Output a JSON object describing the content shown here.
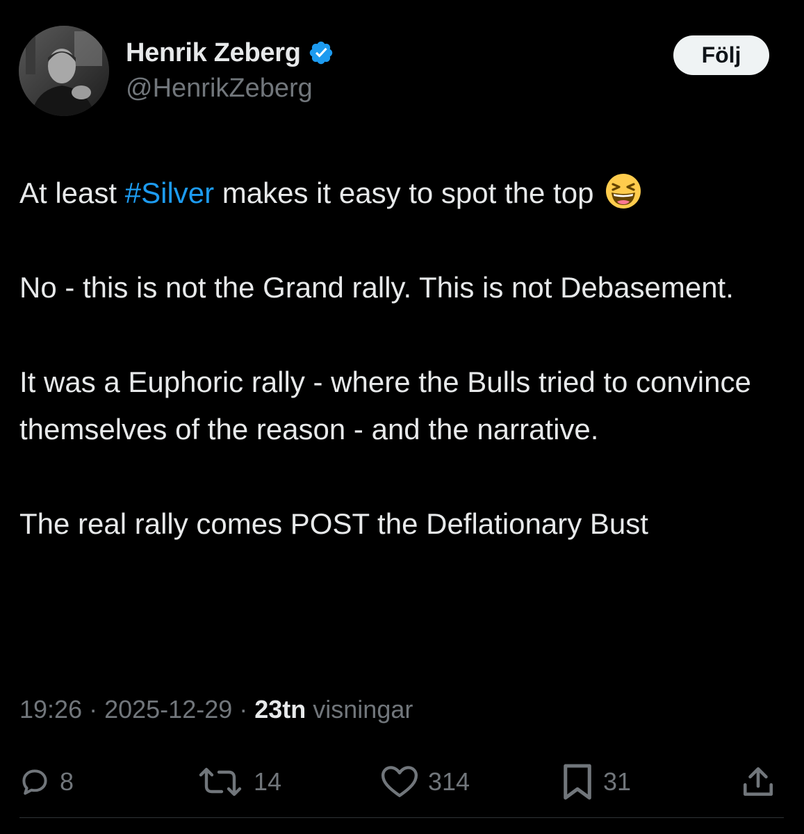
{
  "author": {
    "display_name": "Henrik Zeberg",
    "handle": "@HenrikZeberg",
    "verified": true
  },
  "follow_button": {
    "label": "Följ"
  },
  "tweet": {
    "line1_before": "At least ",
    "hashtag": "#Silver",
    "line1_after": " makes it easy to spot the top",
    "paragraph2": "No - this is not the Grand rally. This is not Debasement.",
    "paragraph3": "It was a Euphoric rally - where the Bulls tried to convince themselves of the reason - and the narrative.",
    "paragraph4": "The real rally comes POST the Deflationary Bust"
  },
  "meta": {
    "time": "19:26",
    "separator": " · ",
    "date": "2025-12-29",
    "views_count": "23tn",
    "views_label": " visningar"
  },
  "actions": {
    "replies": "8",
    "reposts": "14",
    "likes": "314",
    "bookmarks": "31"
  },
  "colors": {
    "background": "#000000",
    "text": "#e7e9ea",
    "secondary": "#71767b",
    "link": "#1d9bf0",
    "verified": "#1d9bf0",
    "follow_bg": "#eff3f4"
  },
  "icons": [
    "verified-badge-icon",
    "grinning-squinting-emoji-icon",
    "reply-icon",
    "repost-icon",
    "like-icon",
    "bookmark-icon",
    "share-icon"
  ]
}
